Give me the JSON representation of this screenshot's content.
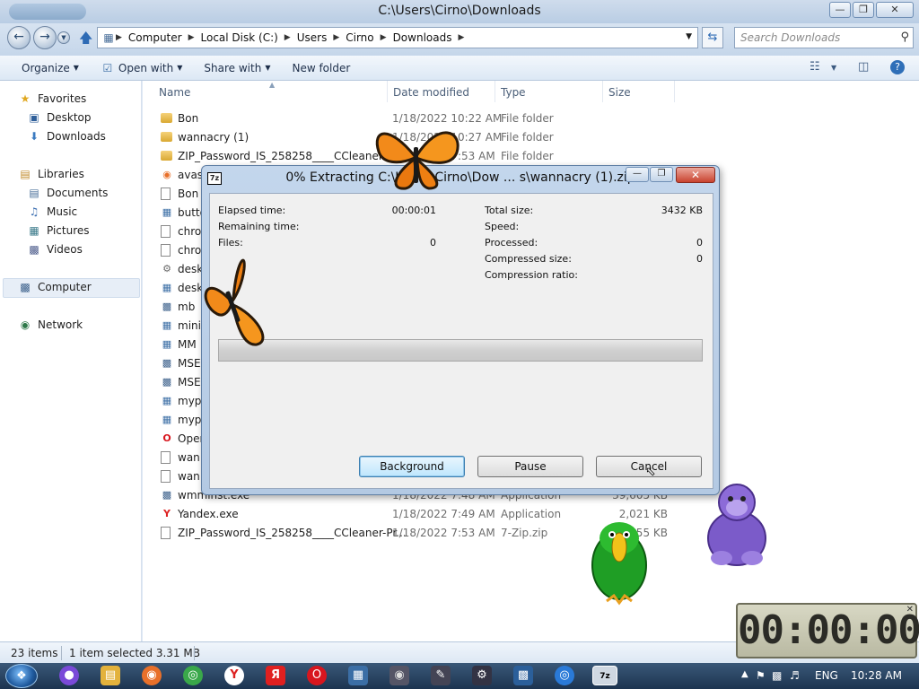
{
  "window": {
    "title": "C:\\Users\\Cirno\\Downloads",
    "min_icon": "minimize-icon",
    "max_icon": "maximize-icon",
    "close_icon": "close-icon"
  },
  "address": {
    "crumbs": [
      "Computer",
      "Local Disk (C:)",
      "Users",
      "Cirno",
      "Downloads"
    ],
    "search_placeholder": "Search Downloads"
  },
  "toolbar": {
    "organize": "Organize",
    "open_with": "Open with",
    "share_with": "Share with",
    "new_folder": "New folder"
  },
  "nav": {
    "favorites": "Favorites",
    "desktop": "Desktop",
    "downloads": "Downloads",
    "libraries": "Libraries",
    "documents": "Documents",
    "music": "Music",
    "pictures": "Pictures",
    "videos": "Videos",
    "computer": "Computer",
    "network": "Network"
  },
  "columns": {
    "name": "Name",
    "date": "Date modified",
    "type": "Type",
    "size": "Size"
  },
  "files": [
    {
      "name": "Bon",
      "date": "1/18/2022 10:22 AM",
      "type": "File folder",
      "size": "",
      "icon": "folder-icon"
    },
    {
      "name": "wannacry (1)",
      "date": "1/18/2022 10:27 AM",
      "type": "File folder",
      "size": "",
      "icon": "folder-icon"
    },
    {
      "name": "ZIP_Password_IS_258258____CCleaner-Pr...",
      "date": "1/18/2022 7:53 AM",
      "type": "File folder",
      "size": "",
      "icon": "folder-icon"
    },
    {
      "name": "avast",
      "date": "",
      "type": "",
      "size": "",
      "icon": "avast-icon"
    },
    {
      "name": "Bon",
      "date": "",
      "type": "",
      "size": "",
      "icon": "file-icon"
    },
    {
      "name": "butto",
      "date": "",
      "type": "",
      "size": "",
      "icon": "setup-icon"
    },
    {
      "name": "chro",
      "date": "",
      "type": "",
      "size": "",
      "icon": "file-icon"
    },
    {
      "name": "chro",
      "date": "",
      "type": "",
      "size": "",
      "icon": "file-icon"
    },
    {
      "name": "desk",
      "date": "",
      "type": "",
      "size": "",
      "icon": "gear-icon"
    },
    {
      "name": "desk",
      "date": "",
      "type": "",
      "size": "",
      "icon": "setup-icon"
    },
    {
      "name": "mb",
      "date": "",
      "type": "",
      "size": "",
      "icon": "app-icon"
    },
    {
      "name": "mini",
      "date": "",
      "type": "",
      "size": "",
      "icon": "setup-icon"
    },
    {
      "name": "MM",
      "date": "",
      "type": "",
      "size": "",
      "icon": "setup-icon"
    },
    {
      "name": "MSE",
      "date": "",
      "type": "",
      "size": "",
      "icon": "app-icon"
    },
    {
      "name": "MSE",
      "date": "",
      "type": "",
      "size": "",
      "icon": "app-icon"
    },
    {
      "name": "myp",
      "date": "",
      "type": "",
      "size": "",
      "icon": "setup-icon"
    },
    {
      "name": "myp",
      "date": "",
      "type": "",
      "size": "",
      "icon": "setup-icon"
    },
    {
      "name": "Oper",
      "date": "",
      "type": "",
      "size": "",
      "icon": "opera-icon"
    },
    {
      "name": "wan",
      "date": "",
      "type": "",
      "size": "",
      "icon": "file-icon"
    },
    {
      "name": "wan",
      "date": "",
      "type": "",
      "size": "",
      "icon": "file-icon"
    },
    {
      "name": "wmminst.exe",
      "date": "1/18/2022 7:48 AM",
      "type": "Application",
      "size": "39,605 KB",
      "icon": "app-icon"
    },
    {
      "name": "Yandex.exe",
      "date": "1/18/2022 7:49 AM",
      "type": "Application",
      "size": "2,021 KB",
      "icon": "yandex-icon"
    },
    {
      "name": "ZIP_Password_IS_258258____CCleaner-Pr...",
      "date": "1/18/2022 7:53 AM",
      "type": "7-Zip.zip",
      "size": "155 KB",
      "icon": "file-icon"
    }
  ],
  "status": {
    "items": "23 items",
    "selected": "1 item selected 3.31 MB"
  },
  "dialog": {
    "title": "0% Extracting C:\\Users\\Cirno\\Dow ... s\\wannacry (1).zip",
    "logo": "7z",
    "elapsed_label": "Elapsed time:",
    "elapsed_value": "00:00:01",
    "remaining_label": "Remaining time:",
    "remaining_value": "",
    "files_label": "Files:",
    "files_value": "0",
    "total_label": "Total size:",
    "total_value": "3432 KB",
    "speed_label": "Speed:",
    "speed_value": "",
    "processed_label": "Processed:",
    "processed_value": "0",
    "compressed_label": "Compressed size:",
    "compressed_value": "0",
    "ratio_label": "Compression ratio:",
    "ratio_value": "",
    "progress_fraction": 0,
    "background_btn": "Background",
    "pause_btn": "Pause",
    "cancel_btn": "Cancel"
  },
  "timer": {
    "display": "00:00:00"
  },
  "taskbar": {
    "language": "ENG",
    "clock": "10:28 AM"
  }
}
